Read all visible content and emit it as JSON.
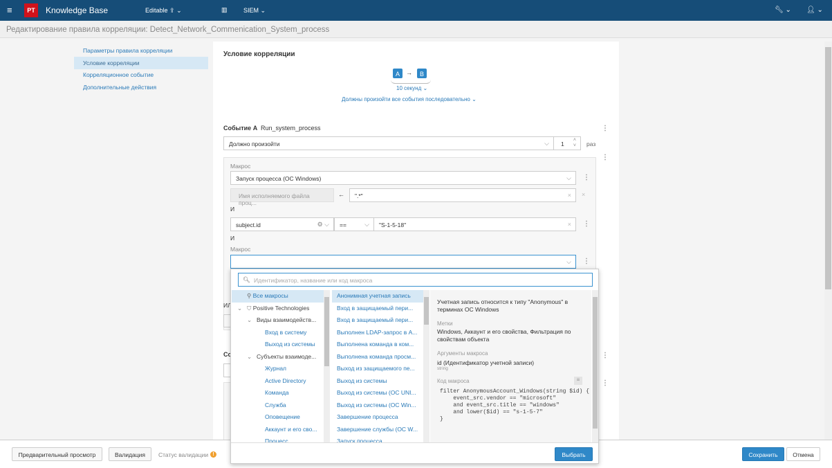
{
  "header": {
    "logo": "PT",
    "app_title": "Knowledge Base",
    "mode": "Editable",
    "product": "SIEM"
  },
  "page_title": "Редактирование правила корреляции: Detect_Network_Commenication_System_process",
  "sidebar": {
    "items": [
      {
        "label": "Параметры правила корреляции"
      },
      {
        "label": "Условие корреляции"
      },
      {
        "label": "Корреляционное событие"
      },
      {
        "label": "Дополнительные действия"
      }
    ]
  },
  "main": {
    "section_title": "Условие корреляции",
    "event_a_badge": "A",
    "event_b_badge": "B",
    "arrow": "→",
    "timeout": "10 секунд",
    "order": "Должны произойти все события последовательно",
    "event_a": {
      "label": "Событие A",
      "name": "Run_system_process",
      "occurrence": "Должно произойти",
      "count": "1",
      "count_unit": "раз",
      "macro_label": "Макрос",
      "macro_value": "Запуск процесса (ОС Windows)",
      "arg_name": "Имя исполняемого файла проц...",
      "arg_arrow": "←",
      "arg_value": "\".*\"",
      "and1": "И",
      "field": "subject.id",
      "operator": "==",
      "field_value": "\"S-1-5-18\"",
      "and2": "И",
      "macro2_label": "Макрос",
      "macro2_value": ""
    },
    "or_label": "ИЛ",
    "event_b_label": "Со"
  },
  "macro_picker": {
    "search_placeholder": "Идентификатор, название или код макроса",
    "tree": [
      {
        "label": "Все макросы",
        "level": 0
      },
      {
        "label": "Positive Technologies",
        "level": 0
      },
      {
        "label": "Виды взаимодейств...",
        "level": 1
      },
      {
        "label": "Вход в систему",
        "level": 2
      },
      {
        "label": "Выход из системы",
        "level": 2
      },
      {
        "label": "Субъекты взаимоде...",
        "level": 1
      },
      {
        "label": "Журнал",
        "level": 2
      },
      {
        "label": "Active Directory",
        "level": 2
      },
      {
        "label": "Команда",
        "level": 2
      },
      {
        "label": "Служба",
        "level": 2
      },
      {
        "label": "Оповещение",
        "level": 2
      },
      {
        "label": "Аккаунт и его сво...",
        "level": 2
      },
      {
        "label": "Процесс",
        "level": 2
      }
    ],
    "macros": [
      "Анонимная учетная запись",
      "Вход в защищаемый пери...",
      "Вход в защищаемый пери...",
      "Выполнен LDAP-запрос в A...",
      "Выполнена команда в ком...",
      "Выполнена команда просм...",
      "Выход из защищаемого пе...",
      "Выход из системы",
      "Выход из системы (ОС UNI...",
      "Выход из системы (ОС Win...",
      "Завершение процесса",
      "Завершение службы (ОС W...",
      "Запуск процесса"
    ],
    "details": {
      "description": "Учетная запись относится к типу \"Anonymous\" в терминах ОС Windows",
      "tags_label": "Метки",
      "tags": "Windows, Аккаунт и его свойства, Фильтрация по свойствам объекта",
      "args_label": "Аргументы макроса",
      "arg": "id (Идентификатор учетной записи)",
      "arg_type": "string",
      "code_label": "Код макроса",
      "code": [
        "filter AnonymousAccount_Windows(string $id) {",
        "    event_src.vendor == \"microsoft\"",
        "    and event_src.title == \"windows\"",
        "    and lower($id) == \"s-1-5-7\"",
        "}"
      ]
    },
    "select_button": "Выбрать"
  },
  "footer": {
    "preview": "Предварительный просмотр",
    "validate": "Валидация",
    "validation_status": "Статус валидации",
    "save": "Сохранить",
    "cancel": "Отмена"
  },
  "colors": {
    "header": "#164d78",
    "accent": "#2f88c8",
    "logo": "#d0121b",
    "warning": "#f0a030"
  }
}
